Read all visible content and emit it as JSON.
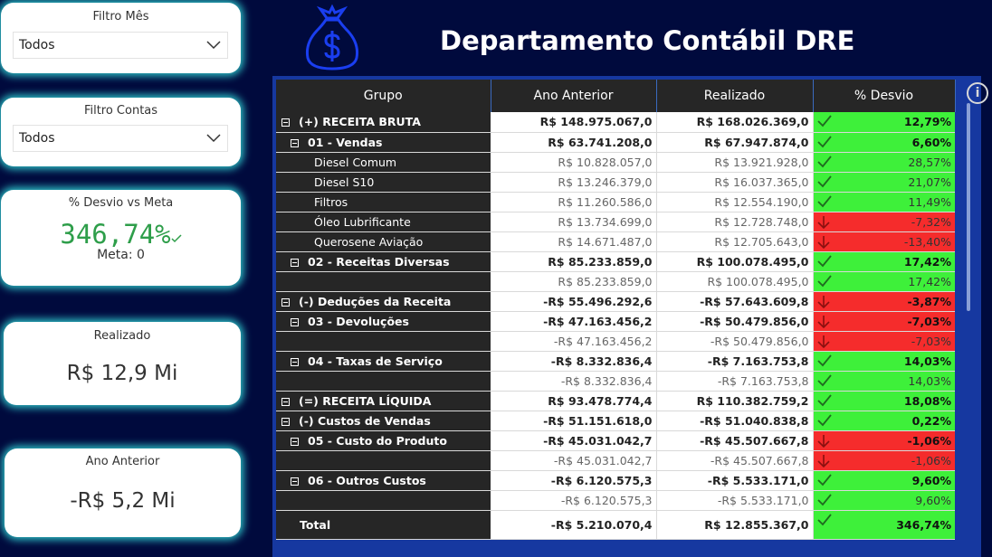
{
  "filters": [
    {
      "title": "Filtro Mês",
      "value": "Todos"
    },
    {
      "title": "Filtro Contas",
      "value": "Todos"
    }
  ],
  "kpis": {
    "desvio": {
      "title": "% Desvio vs Meta",
      "value": "346,74%",
      "meta": "Meta: 0"
    },
    "realizado": {
      "title": "Realizado",
      "value": "R$ 12,9 Mi"
    },
    "ano_anterior": {
      "title": "Ano Anterior",
      "value": "-R$ 5,2 Mi"
    }
  },
  "header": {
    "title": "Departamento Contábil DRE",
    "logo_icon": "money-bag-icon"
  },
  "colors": {
    "background": "#000a3d",
    "positive": "#3ef03a",
    "negative": "#f52c2c",
    "kpi_green": "#2e9e4a",
    "card_glow": "#2ec4c9",
    "logo_blue": "#1a3ef0"
  },
  "table": {
    "columns": [
      "Grupo",
      "Ano Anterior",
      "Realizado",
      "% Desvio"
    ],
    "rows": [
      {
        "label": "(+) RECEITA BRUTA",
        "level": 0,
        "bold": true,
        "expand": true,
        "ano": "R$ 148.975.067,0",
        "real": "R$ 168.026.369,0",
        "dev": "12,79%",
        "status": "pos"
      },
      {
        "label": "01 - Vendas",
        "level": 1,
        "bold": true,
        "expand": true,
        "ano": "R$ 63.741.208,0",
        "real": "R$ 67.947.874,0",
        "dev": "6,60%",
        "status": "pos"
      },
      {
        "label": "Diesel Comum",
        "level": 2,
        "bold": false,
        "expand": false,
        "ano": "R$ 10.828.057,0",
        "real": "R$ 13.921.928,0",
        "dev": "28,57%",
        "status": "pos"
      },
      {
        "label": "Diesel S10",
        "level": 2,
        "bold": false,
        "expand": false,
        "ano": "R$ 13.246.379,0",
        "real": "R$ 16.037.365,0",
        "dev": "21,07%",
        "status": "pos"
      },
      {
        "label": "Filtros",
        "level": 2,
        "bold": false,
        "expand": false,
        "ano": "R$ 11.260.586,0",
        "real": "R$ 12.554.190,0",
        "dev": "11,49%",
        "status": "pos"
      },
      {
        "label": "Óleo Lubrificante",
        "level": 2,
        "bold": false,
        "expand": false,
        "ano": "R$ 13.734.699,0",
        "real": "R$ 12.728.748,0",
        "dev": "-7,32%",
        "status": "neg"
      },
      {
        "label": "Querosene Aviação",
        "level": 2,
        "bold": false,
        "expand": false,
        "ano": "R$ 14.671.487,0",
        "real": "R$ 12.705.643,0",
        "dev": "-13,40%",
        "status": "neg"
      },
      {
        "label": "02 - Receitas Diversas",
        "level": 1,
        "bold": true,
        "expand": true,
        "ano": "R$ 85.233.859,0",
        "real": "R$ 100.078.495,0",
        "dev": "17,42%",
        "status": "pos"
      },
      {
        "label": "",
        "level": 2,
        "bold": false,
        "expand": false,
        "ano": "R$ 85.233.859,0",
        "real": "R$ 100.078.495,0",
        "dev": "17,42%",
        "status": "pos"
      },
      {
        "label": "(-) Deduções da Receita",
        "level": 0,
        "bold": true,
        "expand": true,
        "ano": "-R$ 55.496.292,6",
        "real": "-R$ 57.643.609,8",
        "dev": "-3,87%",
        "status": "neg"
      },
      {
        "label": "03 - Devoluções",
        "level": 1,
        "bold": true,
        "expand": true,
        "ano": "-R$ 47.163.456,2",
        "real": "-R$ 50.479.856,0",
        "dev": "-7,03%",
        "status": "neg"
      },
      {
        "label": "",
        "level": 2,
        "bold": false,
        "expand": false,
        "ano": "-R$ 47.163.456,2",
        "real": "-R$ 50.479.856,0",
        "dev": "-7,03%",
        "status": "neg"
      },
      {
        "label": "04 - Taxas de Serviço",
        "level": 1,
        "bold": true,
        "expand": true,
        "ano": "-R$ 8.332.836,4",
        "real": "-R$ 7.163.753,8",
        "dev": "14,03%",
        "status": "pos"
      },
      {
        "label": "",
        "level": 2,
        "bold": false,
        "expand": false,
        "ano": "-R$ 8.332.836,4",
        "real": "-R$ 7.163.753,8",
        "dev": "14,03%",
        "status": "pos"
      },
      {
        "label": "(=) RECEITA LÍQUIDA",
        "level": 0,
        "bold": true,
        "expand": true,
        "ano": "R$ 93.478.774,4",
        "real": "R$ 110.382.759,2",
        "dev": "18,08%",
        "status": "pos"
      },
      {
        "label": "(-) Custos de Vendas",
        "level": 0,
        "bold": true,
        "expand": true,
        "ano": "-R$ 51.151.618,0",
        "real": "-R$ 51.040.838,8",
        "dev": "0,22%",
        "status": "pos"
      },
      {
        "label": "05 - Custo do Produto",
        "level": 1,
        "bold": true,
        "expand": true,
        "ano": "-R$ 45.031.042,7",
        "real": "-R$ 45.507.667,8",
        "dev": "-1,06%",
        "status": "neg"
      },
      {
        "label": "",
        "level": 2,
        "bold": false,
        "expand": false,
        "ano": "-R$ 45.031.042,7",
        "real": "-R$ 45.507.667,8",
        "dev": "-1,06%",
        "status": "neg"
      },
      {
        "label": "06 - Outros Custos",
        "level": 1,
        "bold": true,
        "expand": true,
        "ano": "-R$ 6.120.575,3",
        "real": "-R$ 5.533.171,0",
        "dev": "9,60%",
        "status": "pos"
      },
      {
        "label": "",
        "level": 2,
        "bold": false,
        "expand": false,
        "ano": "-R$ 6.120.575,3",
        "real": "-R$ 5.533.171,0",
        "dev": "9,60%",
        "status": "pos"
      },
      {
        "label": "Total",
        "level": 0,
        "bold": true,
        "expand": false,
        "ano": "-R$ 5.210.070,4",
        "real": "R$ 12.855.367,0",
        "dev": "346,74%",
        "status": "pos"
      }
    ]
  }
}
